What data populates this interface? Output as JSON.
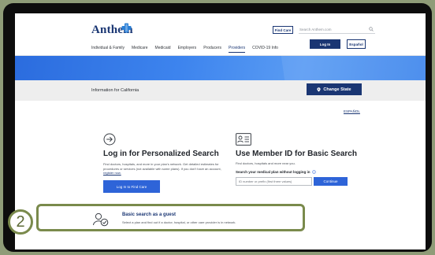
{
  "header": {
    "logo_text": "Anthem",
    "find_care_label": "Find Care",
    "search_placeholder": "Search Anthem.com",
    "login_label": "Log In",
    "language_label": "Español"
  },
  "nav": {
    "items": [
      {
        "label": "Individual & Family"
      },
      {
        "label": "Medicare"
      },
      {
        "label": "Medicaid"
      },
      {
        "label": "Employers"
      },
      {
        "label": "Producers"
      },
      {
        "label": "Providers",
        "active": true
      },
      {
        "label": "COVID-19 Info"
      }
    ]
  },
  "state_band": {
    "label": "Information for California",
    "change_state_label": "Change State"
  },
  "language_link": "ESPAÑOL",
  "login_section": {
    "title": "Log in for Personalized Search",
    "description": "Find doctors, hospitals, and more in your plan's network. Get detailed estimates for procedures or services (not available with some plans). If you don't have an account,",
    "register_link": "register now.",
    "button_label": "Log In to Find Care"
  },
  "member_section": {
    "title": "Use Member ID for Basic Search",
    "description": "Find doctors, hospitals and more near you.",
    "search_label": "Search your medical plan without logging in",
    "input_placeholder": "ID number or prefix (first three values)",
    "button_label": "Continue"
  },
  "guest_section": {
    "title": "Basic search as a guest",
    "description": "Select a plan and find out if a doctor, hospital, or other care provider is in network."
  },
  "annotation": {
    "step_number": "2",
    "accent_color": "#7a8a4c"
  },
  "colors": {
    "brand": "#1a3673",
    "action": "#2e64d8",
    "hero": "#3d84ee"
  }
}
